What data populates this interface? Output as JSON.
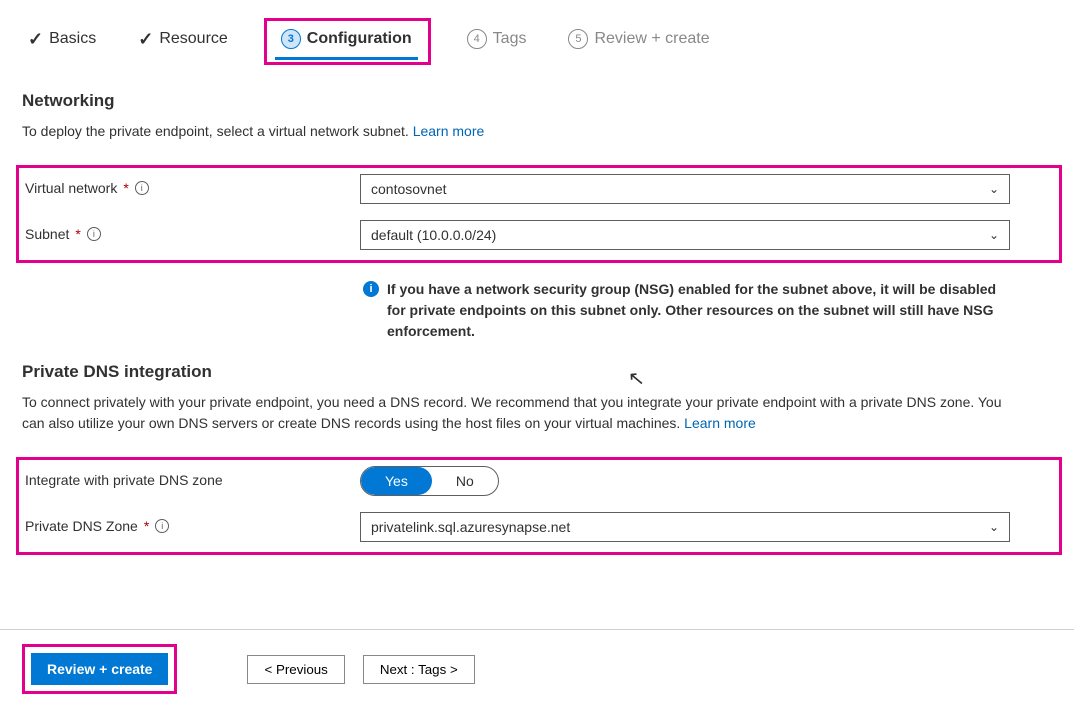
{
  "tabs": {
    "basics": "Basics",
    "resource": "Resource",
    "configuration": "Configuration",
    "tags": "Tags",
    "review": "Review + create",
    "num3": "3",
    "num4": "4",
    "num5": "5"
  },
  "networking": {
    "heading": "Networking",
    "desc": "To deploy the private endpoint, select a virtual network subnet.  ",
    "learn": "Learn more",
    "vnet_label": "Virtual network",
    "vnet_value": "contosovnet",
    "subnet_label": "Subnet",
    "subnet_value": "default (10.0.0.0/24)",
    "note": "If you have a network security group (NSG) enabled for the subnet above, it will be disabled for private endpoints on this subnet only. Other resources on the subnet will still have NSG enforcement."
  },
  "dns": {
    "heading": "Private DNS integration",
    "desc": "To connect privately with your private endpoint, you need a DNS record. We recommend that you integrate your private endpoint with a private DNS zone. You can also utilize your own DNS servers or create DNS records using the host files on your virtual machines.  ",
    "learn": "Learn more",
    "integrate_label": "Integrate with private DNS zone",
    "yes": "Yes",
    "no": "No",
    "zone_label": "Private DNS Zone",
    "zone_value": "privatelink.sql.azuresynapse.net"
  },
  "footer": {
    "review": "Review + create",
    "previous": "< Previous",
    "next": "Next : Tags >"
  },
  "marks": {
    "star": "*",
    "i": "i",
    "check": "✓"
  }
}
